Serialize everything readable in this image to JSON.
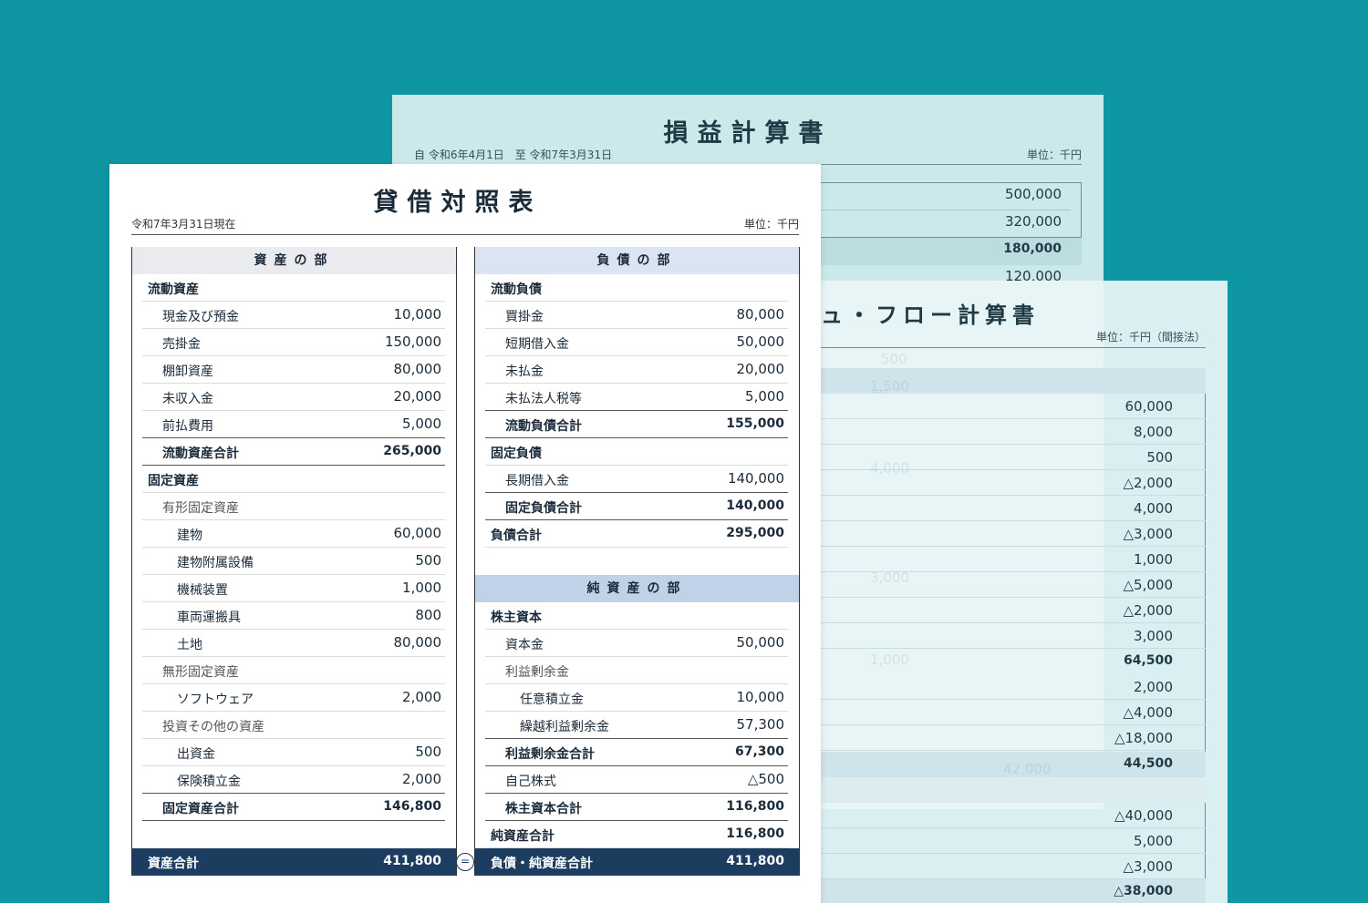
{
  "income_statement": {
    "title": "損益計算書",
    "period": "自 令和6年4月1日　至 令和7年3月31日",
    "unit": "単位：千円",
    "visible_values": [
      {
        "value": "500,000",
        "bold": false
      },
      {
        "value": "320,000",
        "bold": false
      },
      {
        "value": "180,000",
        "bold": true
      },
      {
        "value": "120,000",
        "bold": false
      }
    ]
  },
  "cash_flow": {
    "title": "ュ・フロー計算書",
    "unit": "単位：千円（間接法）",
    "values": [
      {
        "value": "60,000",
        "bold": false
      },
      {
        "value": "8,000",
        "bold": false
      },
      {
        "value": "500",
        "bold": false
      },
      {
        "value": "△2,000",
        "bold": false
      },
      {
        "value": "4,000",
        "bold": false
      },
      {
        "value": "△3,000",
        "bold": false
      },
      {
        "value": "1,000",
        "bold": false
      },
      {
        "value": "△5,000",
        "bold": false
      },
      {
        "value": "△2,000",
        "bold": false
      },
      {
        "value": "3,000",
        "bold": false
      },
      {
        "value": "64,500",
        "bold": true
      },
      {
        "value": "2,000",
        "bold": false
      },
      {
        "value": "△4,000",
        "bold": false
      },
      {
        "value": "△18,000",
        "bold": false
      },
      {
        "value": "44,500",
        "bold": true
      },
      {
        "value": "△40,000",
        "bold": false
      },
      {
        "value": "5,000",
        "bold": false
      },
      {
        "value": "△3,000",
        "bold": false
      },
      {
        "value": "△38,000",
        "bold": true
      }
    ]
  },
  "balance_sheet": {
    "title": "貸借対照表",
    "date": "令和7年3月31日現在",
    "unit": "単位：千円",
    "assets": {
      "header": "資産の部",
      "rows": [
        {
          "label": "流動資産",
          "value": "",
          "style": "l0"
        },
        {
          "label": "現金及び預金",
          "value": "10,000",
          "style": "l1"
        },
        {
          "label": "売掛金",
          "value": "150,000",
          "style": "l1"
        },
        {
          "label": "棚卸資産",
          "value": "80,000",
          "style": "l1"
        },
        {
          "label": "未収入金",
          "value": "20,000",
          "style": "l1"
        },
        {
          "label": "前払費用",
          "value": "5,000",
          "style": "l1"
        },
        {
          "label": "流動資産合計",
          "value": "265,000",
          "style": "l1b"
        },
        {
          "label": "固定資産",
          "value": "",
          "style": "l0"
        },
        {
          "label": "有形固定資産",
          "value": "",
          "style": "l1g"
        },
        {
          "label": "建物",
          "value": "60,000",
          "style": "l2"
        },
        {
          "label": "建物附属設備",
          "value": "500",
          "style": "l2"
        },
        {
          "label": "機械装置",
          "value": "1,000",
          "style": "l2"
        },
        {
          "label": "車両運搬具",
          "value": "800",
          "style": "l2"
        },
        {
          "label": "土地",
          "value": "80,000",
          "style": "l2"
        },
        {
          "label": "無形固定資産",
          "value": "",
          "style": "l1g"
        },
        {
          "label": "ソフトウェア",
          "value": "2,000",
          "style": "l2"
        },
        {
          "label": "投資その他の資産",
          "value": "",
          "style": "l1g"
        },
        {
          "label": "出資金",
          "value": "500",
          "style": "l2"
        },
        {
          "label": "保険積立金",
          "value": "2,000",
          "style": "l2"
        },
        {
          "label": "固定資産合計",
          "value": "146,800",
          "style": "l1b"
        }
      ],
      "total_label": "資産合計",
      "total_value": "411,800"
    },
    "liabilities": {
      "header": "負債の部",
      "rows": [
        {
          "label": "流動負債",
          "value": "",
          "style": "l0"
        },
        {
          "label": "買掛金",
          "value": "80,000",
          "style": "l1"
        },
        {
          "label": "短期借入金",
          "value": "50,000",
          "style": "l1"
        },
        {
          "label": "未払金",
          "value": "20,000",
          "style": "l1"
        },
        {
          "label": "未払法人税等",
          "value": "5,000",
          "style": "l1"
        },
        {
          "label": "流動負債合計",
          "value": "155,000",
          "style": "l1b"
        },
        {
          "label": "固定負債",
          "value": "",
          "style": "l0"
        },
        {
          "label": "長期借入金",
          "value": "140,000",
          "style": "l1"
        },
        {
          "label": "固定負債合計",
          "value": "140,000",
          "style": "l1b"
        },
        {
          "label": "負債合計",
          "value": "295,000",
          "style": "l0"
        }
      ]
    },
    "net_assets": {
      "header": "純資産の部",
      "rows": [
        {
          "label": "株主資本",
          "value": "",
          "style": "l0"
        },
        {
          "label": "資本金",
          "value": "50,000",
          "style": "l1"
        },
        {
          "label": "利益剰余金",
          "value": "",
          "style": "l1g"
        },
        {
          "label": "任意積立金",
          "value": "10,000",
          "style": "l2"
        },
        {
          "label": "繰越利益剰余金",
          "value": "57,300",
          "style": "l2"
        },
        {
          "label": "利益剰余金合計",
          "value": "67,300",
          "style": "l1b"
        },
        {
          "label": "自己株式",
          "value": "△500",
          "style": "l1"
        },
        {
          "label": "株主資本合計",
          "value": "116,800",
          "style": "l1b"
        },
        {
          "label": "純資産合計",
          "value": "116,800",
          "style": "l0"
        }
      ],
      "total_label": "負債・純資産合計",
      "total_value": "411,800"
    },
    "equals_sign": "="
  }
}
